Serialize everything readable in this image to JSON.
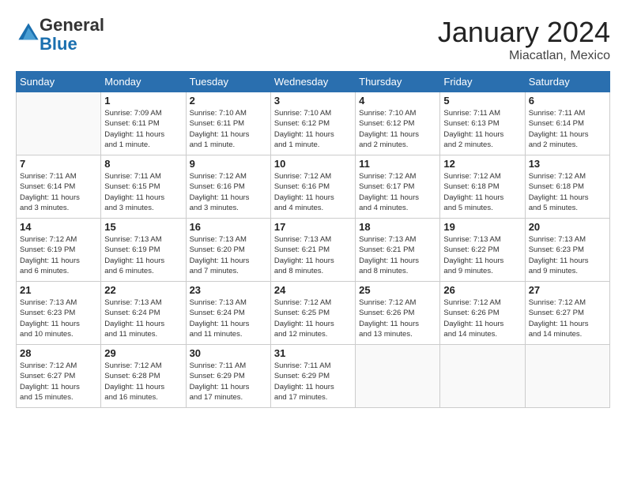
{
  "logo": {
    "general": "General",
    "blue": "Blue"
  },
  "title": "January 2024",
  "location": "Miacatlan, Mexico",
  "headers": [
    "Sunday",
    "Monday",
    "Tuesday",
    "Wednesday",
    "Thursday",
    "Friday",
    "Saturday"
  ],
  "weeks": [
    [
      {
        "day": "",
        "info": ""
      },
      {
        "day": "1",
        "info": "Sunrise: 7:09 AM\nSunset: 6:11 PM\nDaylight: 11 hours\nand 1 minute."
      },
      {
        "day": "2",
        "info": "Sunrise: 7:10 AM\nSunset: 6:11 PM\nDaylight: 11 hours\nand 1 minute."
      },
      {
        "day": "3",
        "info": "Sunrise: 7:10 AM\nSunset: 6:12 PM\nDaylight: 11 hours\nand 1 minute."
      },
      {
        "day": "4",
        "info": "Sunrise: 7:10 AM\nSunset: 6:12 PM\nDaylight: 11 hours\nand 2 minutes."
      },
      {
        "day": "5",
        "info": "Sunrise: 7:11 AM\nSunset: 6:13 PM\nDaylight: 11 hours\nand 2 minutes."
      },
      {
        "day": "6",
        "info": "Sunrise: 7:11 AM\nSunset: 6:14 PM\nDaylight: 11 hours\nand 2 minutes."
      }
    ],
    [
      {
        "day": "7",
        "info": "Sunrise: 7:11 AM\nSunset: 6:14 PM\nDaylight: 11 hours\nand 3 minutes."
      },
      {
        "day": "8",
        "info": "Sunrise: 7:11 AM\nSunset: 6:15 PM\nDaylight: 11 hours\nand 3 minutes."
      },
      {
        "day": "9",
        "info": "Sunrise: 7:12 AM\nSunset: 6:16 PM\nDaylight: 11 hours\nand 3 minutes."
      },
      {
        "day": "10",
        "info": "Sunrise: 7:12 AM\nSunset: 6:16 PM\nDaylight: 11 hours\nand 4 minutes."
      },
      {
        "day": "11",
        "info": "Sunrise: 7:12 AM\nSunset: 6:17 PM\nDaylight: 11 hours\nand 4 minutes."
      },
      {
        "day": "12",
        "info": "Sunrise: 7:12 AM\nSunset: 6:18 PM\nDaylight: 11 hours\nand 5 minutes."
      },
      {
        "day": "13",
        "info": "Sunrise: 7:12 AM\nSunset: 6:18 PM\nDaylight: 11 hours\nand 5 minutes."
      }
    ],
    [
      {
        "day": "14",
        "info": "Sunrise: 7:12 AM\nSunset: 6:19 PM\nDaylight: 11 hours\nand 6 minutes."
      },
      {
        "day": "15",
        "info": "Sunrise: 7:13 AM\nSunset: 6:19 PM\nDaylight: 11 hours\nand 6 minutes."
      },
      {
        "day": "16",
        "info": "Sunrise: 7:13 AM\nSunset: 6:20 PM\nDaylight: 11 hours\nand 7 minutes."
      },
      {
        "day": "17",
        "info": "Sunrise: 7:13 AM\nSunset: 6:21 PM\nDaylight: 11 hours\nand 8 minutes."
      },
      {
        "day": "18",
        "info": "Sunrise: 7:13 AM\nSunset: 6:21 PM\nDaylight: 11 hours\nand 8 minutes."
      },
      {
        "day": "19",
        "info": "Sunrise: 7:13 AM\nSunset: 6:22 PM\nDaylight: 11 hours\nand 9 minutes."
      },
      {
        "day": "20",
        "info": "Sunrise: 7:13 AM\nSunset: 6:23 PM\nDaylight: 11 hours\nand 9 minutes."
      }
    ],
    [
      {
        "day": "21",
        "info": "Sunrise: 7:13 AM\nSunset: 6:23 PM\nDaylight: 11 hours\nand 10 minutes."
      },
      {
        "day": "22",
        "info": "Sunrise: 7:13 AM\nSunset: 6:24 PM\nDaylight: 11 hours\nand 11 minutes."
      },
      {
        "day": "23",
        "info": "Sunrise: 7:13 AM\nSunset: 6:24 PM\nDaylight: 11 hours\nand 11 minutes."
      },
      {
        "day": "24",
        "info": "Sunrise: 7:12 AM\nSunset: 6:25 PM\nDaylight: 11 hours\nand 12 minutes."
      },
      {
        "day": "25",
        "info": "Sunrise: 7:12 AM\nSunset: 6:26 PM\nDaylight: 11 hours\nand 13 minutes."
      },
      {
        "day": "26",
        "info": "Sunrise: 7:12 AM\nSunset: 6:26 PM\nDaylight: 11 hours\nand 14 minutes."
      },
      {
        "day": "27",
        "info": "Sunrise: 7:12 AM\nSunset: 6:27 PM\nDaylight: 11 hours\nand 14 minutes."
      }
    ],
    [
      {
        "day": "28",
        "info": "Sunrise: 7:12 AM\nSunset: 6:27 PM\nDaylight: 11 hours\nand 15 minutes."
      },
      {
        "day": "29",
        "info": "Sunrise: 7:12 AM\nSunset: 6:28 PM\nDaylight: 11 hours\nand 16 minutes."
      },
      {
        "day": "30",
        "info": "Sunrise: 7:11 AM\nSunset: 6:29 PM\nDaylight: 11 hours\nand 17 minutes."
      },
      {
        "day": "31",
        "info": "Sunrise: 7:11 AM\nSunset: 6:29 PM\nDaylight: 11 hours\nand 17 minutes."
      },
      {
        "day": "",
        "info": ""
      },
      {
        "day": "",
        "info": ""
      },
      {
        "day": "",
        "info": ""
      }
    ]
  ]
}
